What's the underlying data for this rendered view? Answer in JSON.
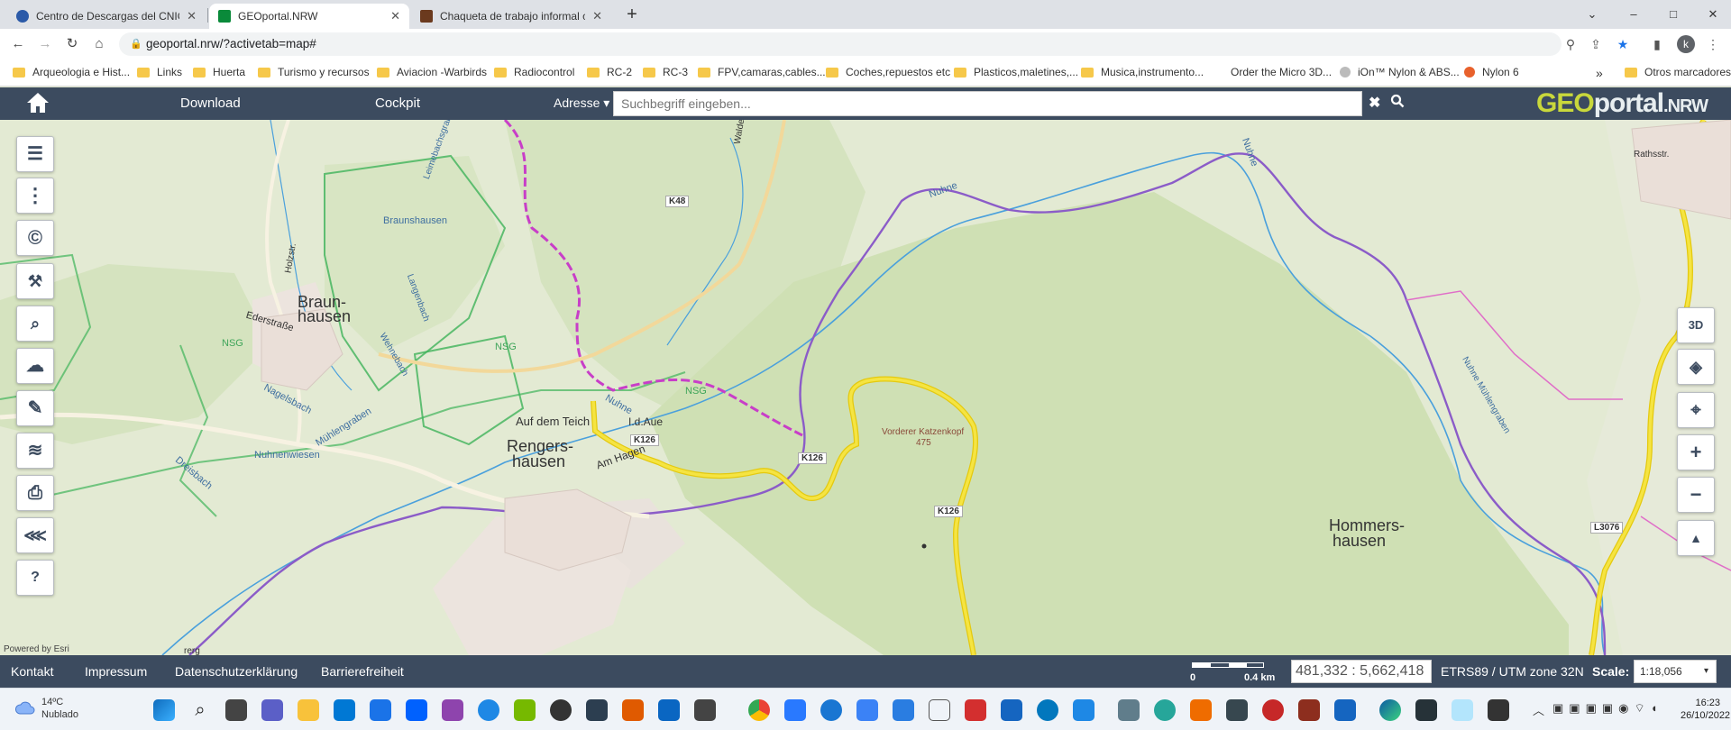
{
  "tabs": [
    {
      "title": "Centro de Descargas del CNIG (I",
      "fav_color": "#2b5aa8"
    },
    {
      "title": "GEOportal.NRW",
      "fav_color": "#0a8a3a"
    },
    {
      "title": "Chaqueta de trabajo informal cá",
      "fav_color": "#6b3a1e"
    }
  ],
  "window": {
    "minimize": "–",
    "maximize": "□",
    "close": "✕",
    "tab_search": "⌄",
    "new_tab": "+"
  },
  "address": {
    "url": "geoportal.nrw/?activetab=map#",
    "profile_initial": "k"
  },
  "bookmarks": [
    "Arqueologia e Hist...",
    "Links",
    "Huerta",
    "Turismo y recursos",
    "Aviacion -Warbirds",
    "Radiocontrol",
    "RC-2",
    "RC-3",
    "FPV,camaras,cables...",
    "Coches,repuestos etc",
    "Plasticos,maletines,...",
    "Musica,instrumento...",
    "Order the Micro 3D...",
    "iOn™ Nylon & ABS...",
    "Nylon 6"
  ],
  "bookmarks_more": "»",
  "bookmarks_other": "Otros marcadores",
  "app": {
    "nav": [
      "Download",
      "Cockpit"
    ],
    "adresse_label": "Adresse ▾",
    "search_placeholder": "Suchbegriff eingeben...",
    "clear_icon": "✖",
    "search_icon": "🔍",
    "logo_geo": "GEO",
    "logo_portal": "portal",
    "logo_nrw": ".NRW"
  },
  "map_tools_left": [
    {
      "name": "legend-list-icon",
      "glyph": "☰"
    },
    {
      "name": "more-menu-icon",
      "glyph": "⋮"
    },
    {
      "name": "copyright-icon",
      "glyph": "©"
    },
    {
      "name": "tools-wrench-icon",
      "glyph": "🔧"
    },
    {
      "name": "search-document-icon",
      "glyph": "🗎"
    },
    {
      "name": "cloud-download-icon",
      "glyph": "☁"
    },
    {
      "name": "draw-pencil-icon",
      "glyph": "✎"
    },
    {
      "name": "layer-settings-icon",
      "glyph": "≋"
    },
    {
      "name": "print-icon",
      "glyph": "⎙"
    },
    {
      "name": "share-icon",
      "glyph": "⋖"
    },
    {
      "name": "help-icon",
      "glyph": "?"
    }
  ],
  "map_tools_right": [
    {
      "name": "3d-view-icon",
      "glyph": "3D"
    },
    {
      "name": "layers-icon",
      "glyph": "◈"
    },
    {
      "name": "locate-icon",
      "glyph": "⌖"
    },
    {
      "name": "zoom-in-icon",
      "glyph": "+"
    },
    {
      "name": "zoom-out-icon",
      "glyph": "−"
    },
    {
      "name": "compass-north-icon",
      "glyph": "▲"
    }
  ],
  "map_labels": {
    "braunshausen_small": "Braunshausen",
    "braunshausen_town": "Braunshausen_town",
    "braun": "Braun-",
    "hausen": "hausen",
    "ederstrasse": "Ederstraße",
    "holzstr": "Holzstr.",
    "leimebach": "Leimebachsgraben",
    "langenbach": "Langenbach",
    "wehnebach": "Wehnebach",
    "nagelsbach": "Nagelsbach",
    "muhlengraben": "Mühlengraben",
    "dreisbach": "Dreisbach",
    "nuhnenwiesen": "Nuhnenwiesen",
    "nsg1": "NSG",
    "nsg2": "NSG",
    "nsg3": "NSG",
    "auf_dem_teich": "Auf dem Teich",
    "i_d_aue": "I.d.Aue",
    "nuhne": "Nuhne",
    "nuhne2": "Nuhne",
    "nuhne3": "Nuhne",
    "rengers": "Rengers-",
    "rengers_hausen": "hausen",
    "am_hagen": "Am Hagen",
    "k126_a": "K126",
    "k126_b": "K126",
    "k126_c": "K126",
    "k48": "K48",
    "waldecke": "Waldecke",
    "vorderer_katzenkopf": "Vorderer Katzenkopf",
    "elev_475": "475",
    "hommers": "Hommers-",
    "hommers_hausen": "hausen",
    "rathsstr": "Rathsstr.",
    "nuhne_muhlengraben": "Nuhne Mühlengraben",
    "l3076": "L3076",
    "rerg": "rerg"
  },
  "powered_by": "Powered by Esri",
  "footer": {
    "links": [
      "Kontakt",
      "Impressum",
      "Datenschutzerklärung",
      "Barrierefreiheit"
    ],
    "scale_zero": "0",
    "scale_dist": "0.4 km",
    "coords": "481,332 : 5,662,418",
    "crs": "ETRS89 / UTM zone 32N",
    "scale_label": "Scale:",
    "scale_value": "1:18,056"
  },
  "taskbar": {
    "temp": "14ºC",
    "weather": "Nublado",
    "time": "16:23",
    "date": "26/10/2022"
  },
  "colors": {
    "appbar": "#3c4b5f",
    "route_pink": "#c83ec8",
    "route_purple": "#8b5cc8",
    "road_yellow": "#f0dc28",
    "river": "#4aa0dc",
    "forest": "#c7dbae",
    "nsg_green": "#3fb35a"
  }
}
